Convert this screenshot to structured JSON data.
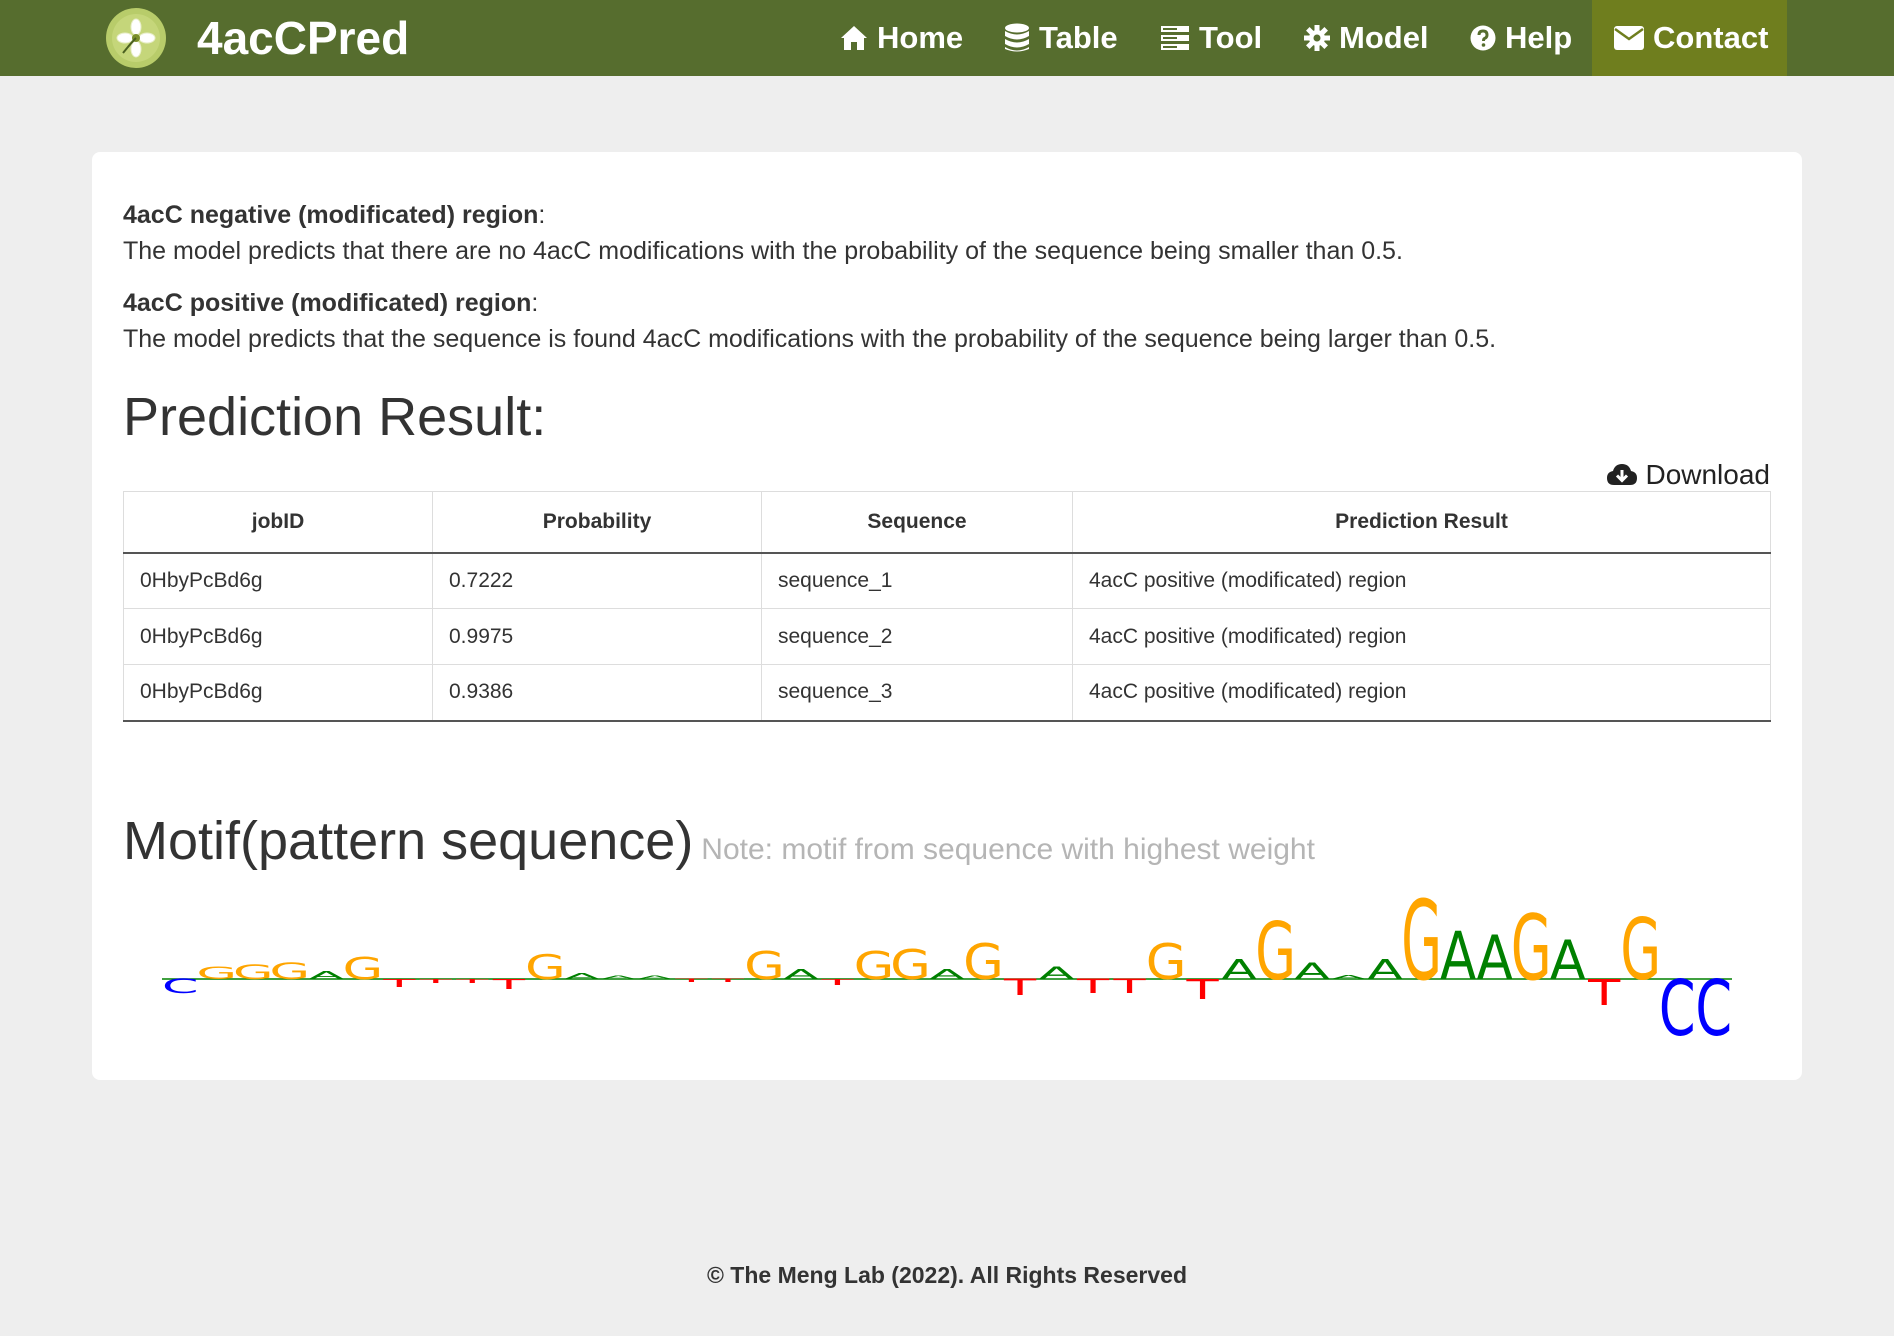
{
  "nav": {
    "brand": "4acCPred",
    "items": [
      {
        "label": "Home",
        "icon": "home-icon"
      },
      {
        "label": "Table",
        "icon": "database-icon"
      },
      {
        "label": "Tool",
        "icon": "server-icon"
      },
      {
        "label": "Model",
        "icon": "gear-icon"
      },
      {
        "label": "Help",
        "icon": "question-circle-icon"
      },
      {
        "label": "Contact",
        "icon": "envelope-icon"
      }
    ],
    "active_color": "#6f7e1e",
    "bar_color": "#566d2e"
  },
  "definitions": {
    "negative": {
      "title": "4acC negative (modificated) region",
      "text": "The model predicts that there are no 4acC modifications with the probability of the sequence being smaller than 0.5."
    },
    "positive": {
      "title": "4acC positive (modificated) region",
      "text": "The model predicts that the sequence is found 4acC modifications with the probability of the sequence being larger than 0.5."
    }
  },
  "prediction": {
    "title": "Prediction Result:",
    "download_label": "Download",
    "columns": [
      "jobID",
      "Probability",
      "Sequence",
      "Prediction Result"
    ],
    "rows": [
      [
        "0HbyPcBd6g",
        "0.7222",
        "sequence_1",
        "4acC positive (modificated) region"
      ],
      [
        "0HbyPcBd6g",
        "0.9975",
        "sequence_2",
        "4acC positive (modificated) region"
      ],
      [
        "0HbyPcBd6g",
        "0.9386",
        "sequence_3",
        "4acC positive (modificated) region"
      ]
    ]
  },
  "motif": {
    "title": "Motif(pattern sequence)",
    "note": "Note: motif from sequence with highest weight",
    "colors": {
      "A": "#008000",
      "C": "#0000ff",
      "G": "#ffa500",
      "T": "#ff0000"
    },
    "positions": [
      {
        "letter": "C",
        "weight": -0.14
      },
      {
        "letter": "G",
        "weight": 0.12
      },
      {
        "letter": "G",
        "weight": 0.14
      },
      {
        "letter": "G",
        "weight": 0.16
      },
      {
        "letter": "A",
        "weight": 0.08
      },
      {
        "letter": "G",
        "weight": 0.22
      },
      {
        "letter": "T",
        "weight": -0.08
      },
      {
        "letter": "T",
        "weight": -0.04
      },
      {
        "letter": "T",
        "weight": -0.04
      },
      {
        "letter": "T",
        "weight": -0.1
      },
      {
        "letter": "G",
        "weight": 0.25
      },
      {
        "letter": "A",
        "weight": 0.06
      },
      {
        "letter": "A",
        "weight": 0.03
      },
      {
        "letter": "A",
        "weight": 0.03
      },
      {
        "letter": "T",
        "weight": -0.03
      },
      {
        "letter": "T",
        "weight": -0.03
      },
      {
        "letter": "G",
        "weight": 0.28
      },
      {
        "letter": "A",
        "weight": 0.1
      },
      {
        "letter": "T",
        "weight": -0.06
      },
      {
        "letter": "G",
        "weight": 0.28
      },
      {
        "letter": "G",
        "weight": 0.3
      },
      {
        "letter": "A",
        "weight": 0.1
      },
      {
        "letter": "G",
        "weight": 0.36
      },
      {
        "letter": "T",
        "weight": -0.16
      },
      {
        "letter": "A",
        "weight": 0.12
      },
      {
        "letter": "T",
        "weight": -0.14
      },
      {
        "letter": "T",
        "weight": -0.14
      },
      {
        "letter": "G",
        "weight": 0.36
      },
      {
        "letter": "T",
        "weight": -0.2
      },
      {
        "letter": "A",
        "weight": 0.2
      },
      {
        "letter": "G",
        "weight": 0.58
      },
      {
        "letter": "A",
        "weight": 0.16
      },
      {
        "letter": "A",
        "weight": 0.04
      },
      {
        "letter": "A",
        "weight": 0.2
      },
      {
        "letter": "G",
        "weight": 0.8
      },
      {
        "letter": "A",
        "weight": 0.48
      },
      {
        "letter": "A",
        "weight": 0.44
      },
      {
        "letter": "G",
        "weight": 0.66
      },
      {
        "letter": "A",
        "weight": 0.4
      },
      {
        "letter": "T",
        "weight": -0.26
      },
      {
        "letter": "G",
        "weight": 0.62
      },
      {
        "letter": "C",
        "weight": -0.56
      },
      {
        "letter": "C",
        "weight": -0.56
      }
    ]
  },
  "footer": "© The Meng Lab (2022). All Rights Reserved"
}
